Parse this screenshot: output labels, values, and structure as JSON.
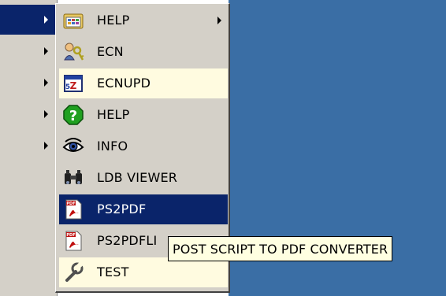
{
  "menu": {
    "items": [
      {
        "label": "HELP",
        "icon": "program-group-icon",
        "has_submenu": true
      },
      {
        "label": "ECN",
        "icon": "key-user-icon",
        "has_submenu": false
      },
      {
        "label": "ECNUPD",
        "icon": "calendar-icon",
        "has_submenu": false
      },
      {
        "label": "HELP",
        "icon": "help-question-icon",
        "has_submenu": false
      },
      {
        "label": "INFO",
        "icon": "eye-icon",
        "has_submenu": false
      },
      {
        "label": "LDB VIEWER",
        "icon": "binoculars-icon",
        "has_submenu": false
      },
      {
        "label": "PS2PDF",
        "icon": "pdf-icon",
        "has_submenu": false
      },
      {
        "label": "PS2PDFLI",
        "icon": "pdf-icon",
        "has_submenu": false
      },
      {
        "label": "TEST",
        "icon": "wrench-icon",
        "has_submenu": false
      }
    ],
    "selected_label": "PS2PDF"
  },
  "tooltip": {
    "text": "POST SCRIPT TO PDF CONVERTER"
  },
  "colors": {
    "desktop": "#3a6ea5",
    "menu_face": "#d4d0c8",
    "highlight": "#0a246a",
    "tooltip_bg": "#ffffe1"
  }
}
